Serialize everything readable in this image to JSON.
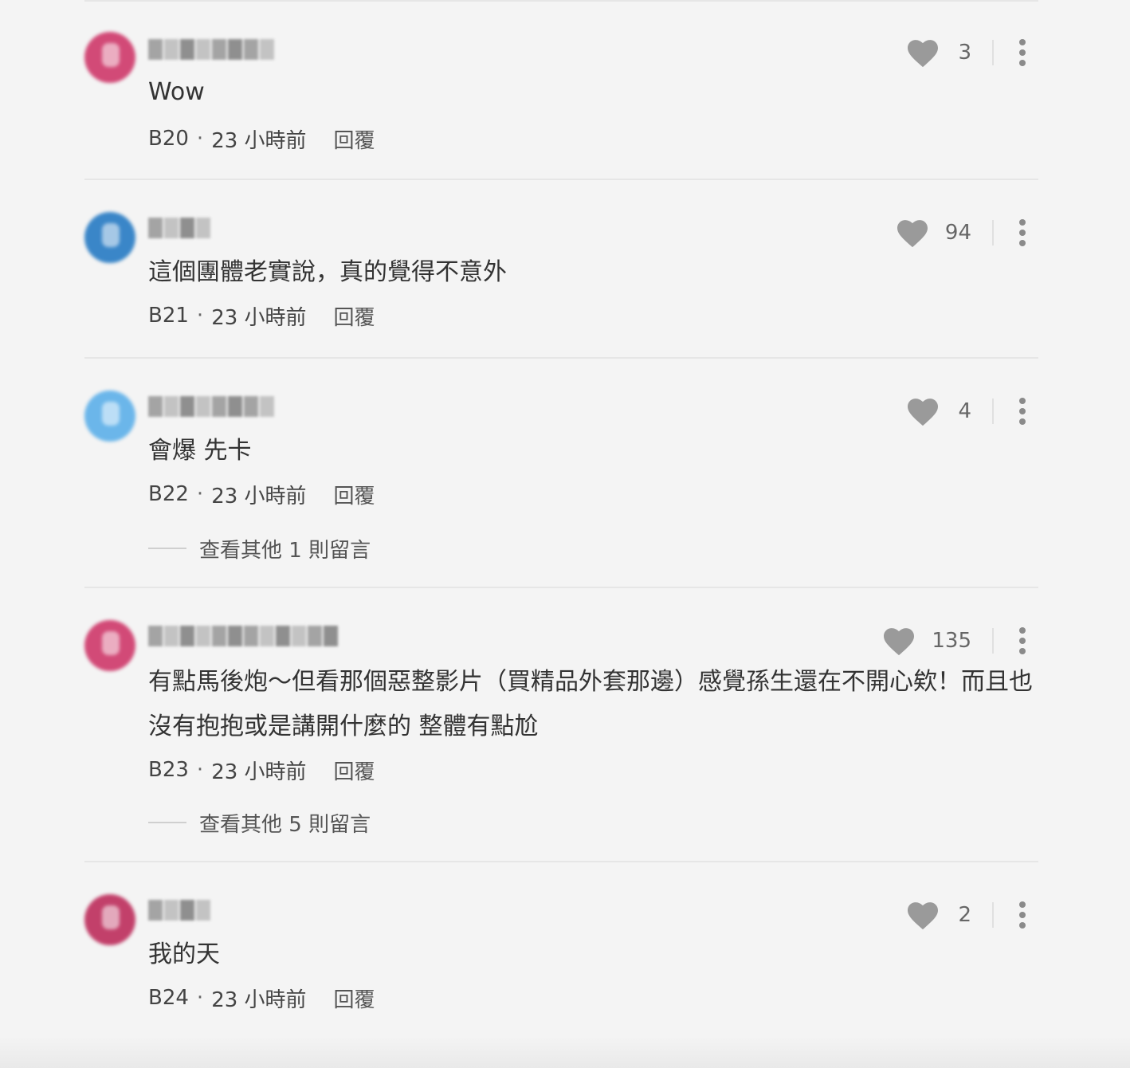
{
  "comments": [
    {
      "avatar_color": "#d24a77",
      "text": "Wow",
      "floor": "B20",
      "time": "23 小時前",
      "reply_label": "回覆",
      "likes": "3",
      "more_replies": ""
    },
    {
      "avatar_color": "#3a86c8",
      "text": "這個團體老實說，真的覺得不意外",
      "floor": "B21",
      "time": "23 小時前",
      "reply_label": "回覆",
      "likes": "94",
      "more_replies": ""
    },
    {
      "avatar_color": "#6bb6ea",
      "text": "會爆 先卡",
      "floor": "B22",
      "time": "23 小時前",
      "reply_label": "回覆",
      "likes": "4",
      "more_replies": "查看其他 1 則留言"
    },
    {
      "avatar_color": "#d24a77",
      "text": "有點馬後炮～但看那個惡整影片（買精品外套那邊）感覺孫生還在不開心欸！而且也沒有抱抱或是講開什麼的 整體有點尬",
      "floor": "B23",
      "time": "23 小時前",
      "reply_label": "回覆",
      "likes": "135",
      "more_replies": "查看其他 5 則留言"
    },
    {
      "avatar_color": "#c2406a",
      "text": "我的天",
      "floor": "B24",
      "time": "23 小時前",
      "reply_label": "回覆",
      "likes": "2",
      "more_replies": ""
    }
  ],
  "meta_separator": "·",
  "icons": {
    "like": "heart-icon",
    "more": "more-vertical-icon"
  },
  "colors": {
    "background": "#f4f4f4",
    "divider": "#e6e6e6",
    "heart": "#9a9a9a"
  }
}
